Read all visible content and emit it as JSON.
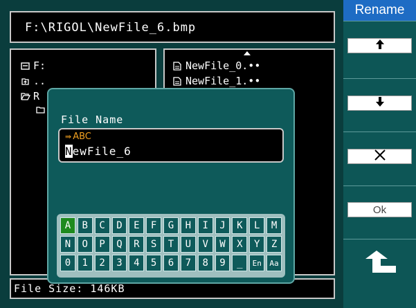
{
  "path_bar": {
    "text": "F:\\RIGOL\\NewFile_6.bmp"
  },
  "dir_tree": [
    {
      "icon": "drive-icon",
      "label": "F:"
    },
    {
      "icon": "parent-dir-icon",
      "label": ".."
    },
    {
      "icon": "open-folder-icon",
      "label": "R"
    },
    {
      "icon": "folder-icon",
      "label": ""
    }
  ],
  "file_list": [
    {
      "icon": "file-icon",
      "label": "NewFile_0.••"
    },
    {
      "icon": "file-icon",
      "label": "NewFile_1.••"
    }
  ],
  "size_bar": {
    "text": "File Size: 146KB"
  },
  "dialog": {
    "title": "File Name",
    "input_mode": "ABC",
    "cursor_char": "N",
    "name_rest": "ewFile_6",
    "keyboard": {
      "rows": [
        [
          "A",
          "B",
          "C",
          "D",
          "E",
          "F",
          "G",
          "H",
          "I",
          "J",
          "K",
          "L",
          "M"
        ],
        [
          "N",
          "O",
          "P",
          "Q",
          "R",
          "S",
          "T",
          "U",
          "V",
          "W",
          "X",
          "Y",
          "Z"
        ],
        [
          "0",
          "1",
          "2",
          "3",
          "4",
          "5",
          "6",
          "7",
          "8",
          "9",
          "_",
          "En",
          "Aa"
        ]
      ],
      "selected": "A"
    }
  },
  "menu": {
    "title": "Rename",
    "items": [
      {
        "icon": "arrow-up-icon"
      },
      {
        "icon": "arrow-down-icon"
      },
      {
        "icon": "delete-x-icon"
      },
      {
        "label": "Ok"
      },
      {
        "icon": "back-arrow-icon"
      }
    ]
  },
  "colors": {
    "background": "#0a3d3d",
    "menu_title": "#1e6cc4",
    "ime_orange": "#f0a020",
    "key_selected": "#1e8a1e"
  }
}
